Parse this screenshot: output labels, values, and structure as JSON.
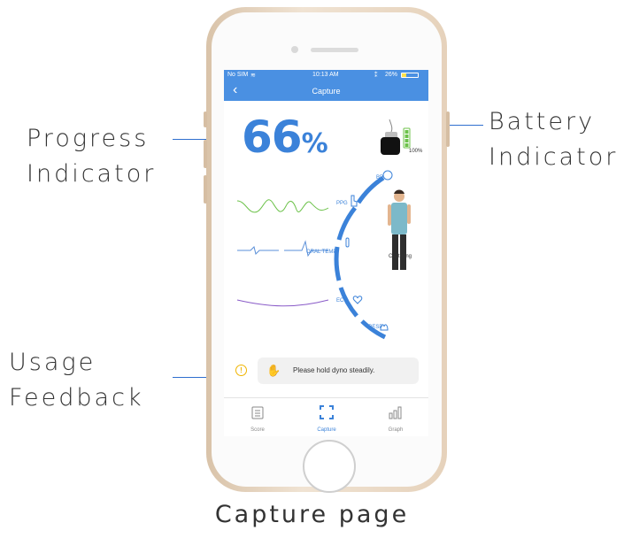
{
  "annotations": {
    "progress": [
      "Progress",
      "Indicator"
    ],
    "battery": [
      "Battery",
      "Indicator"
    ],
    "usage": [
      "Usage",
      "Feedback"
    ],
    "caption": "Capture page"
  },
  "statusbar": {
    "carrier": "No SIM",
    "time": "10:13 AM",
    "battery": "26%"
  },
  "navbar": {
    "back": "‹",
    "title": "Capture"
  },
  "progress": {
    "value": "66",
    "unit": "%"
  },
  "device_battery": {
    "label": "100%",
    "level": 1.0
  },
  "sensors": {
    "bp": "BP",
    "ppg": "PPG",
    "oral_temp": "ORAL TEMP",
    "ecg": "ECG",
    "resp": "RESP"
  },
  "status_text": "Capturing",
  "feedback": {
    "message": "Please hold dyno steadily."
  },
  "tabs": [
    {
      "label": "Score",
      "icon": "clipboard-icon"
    },
    {
      "label": "Capture",
      "icon": "capture-frame-icon"
    },
    {
      "label": "Graph",
      "icon": "bar-graph-icon"
    }
  ],
  "colors": {
    "accent": "#4a90e2",
    "primary_text": "#3b82d9",
    "warning": "#f0b400",
    "ppg_wave": "#6cc24a",
    "resp_wave": "#8a5cc8"
  }
}
